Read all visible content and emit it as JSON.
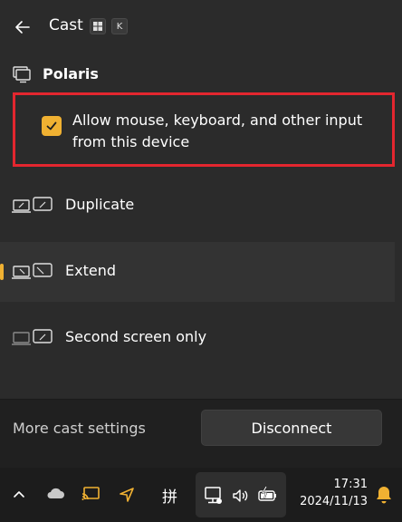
{
  "header": {
    "title": "Cast",
    "shortcut_key": "K"
  },
  "device": {
    "name": "Polaris"
  },
  "allow_input": {
    "label": "Allow mouse, keyboard, and other input from this device",
    "checked": true
  },
  "modes": [
    {
      "label": "Duplicate",
      "selected": false
    },
    {
      "label": "Extend",
      "selected": true
    },
    {
      "label": "Second screen only",
      "selected": false
    }
  ],
  "footer": {
    "more_settings": "More cast settings",
    "disconnect": "Disconnect"
  },
  "taskbar": {
    "ime": "拼",
    "time": "17:31",
    "date": "2024/11/13"
  },
  "colors": {
    "accent": "#f0b132",
    "highlight_border": "#e3262f"
  }
}
